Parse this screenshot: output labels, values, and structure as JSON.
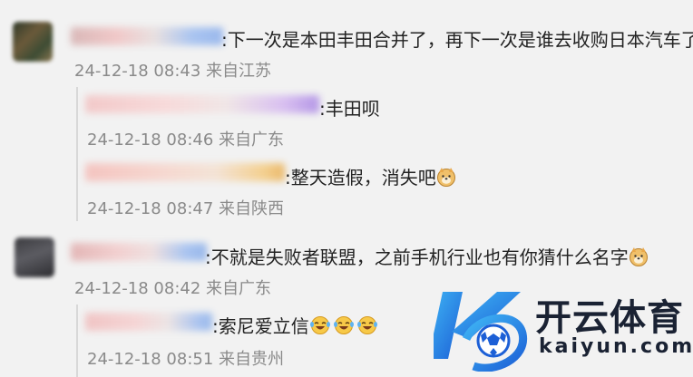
{
  "comments": [
    {
      "text": ":下一次是本田丰田合并了，再下一次是谁去收购日本汽车了",
      "meta": "24-12-18 08:43 来自江苏",
      "replies": [
        {
          "text": ":丰田呗",
          "meta": "24-12-18 08:46 来自广东"
        },
        {
          "text": ":整天造假，消失吧",
          "meta": "24-12-18 08:47 来自陕西",
          "emoji": "doge-emoji"
        }
      ]
    },
    {
      "text": ":不就是失败者联盟，之前手机行业也有你猜什么名字",
      "meta": "24-12-18 08:42 来自广东",
      "emoji": "doge-emoji",
      "replies": [
        {
          "text": ":索尼爱立信",
          "meta": "24-12-18 08:51 来自贵州",
          "emoji": "laugh-cry-emoji",
          "emoji_count": 3
        }
      ]
    }
  ],
  "watermark": {
    "cn": "开云体育",
    "en": "kaiyun.com"
  },
  "colors": {
    "background": "#f2f2f2",
    "text": "#222222",
    "meta": "#8a8a8a",
    "logo_blue": "#1e7be0"
  }
}
